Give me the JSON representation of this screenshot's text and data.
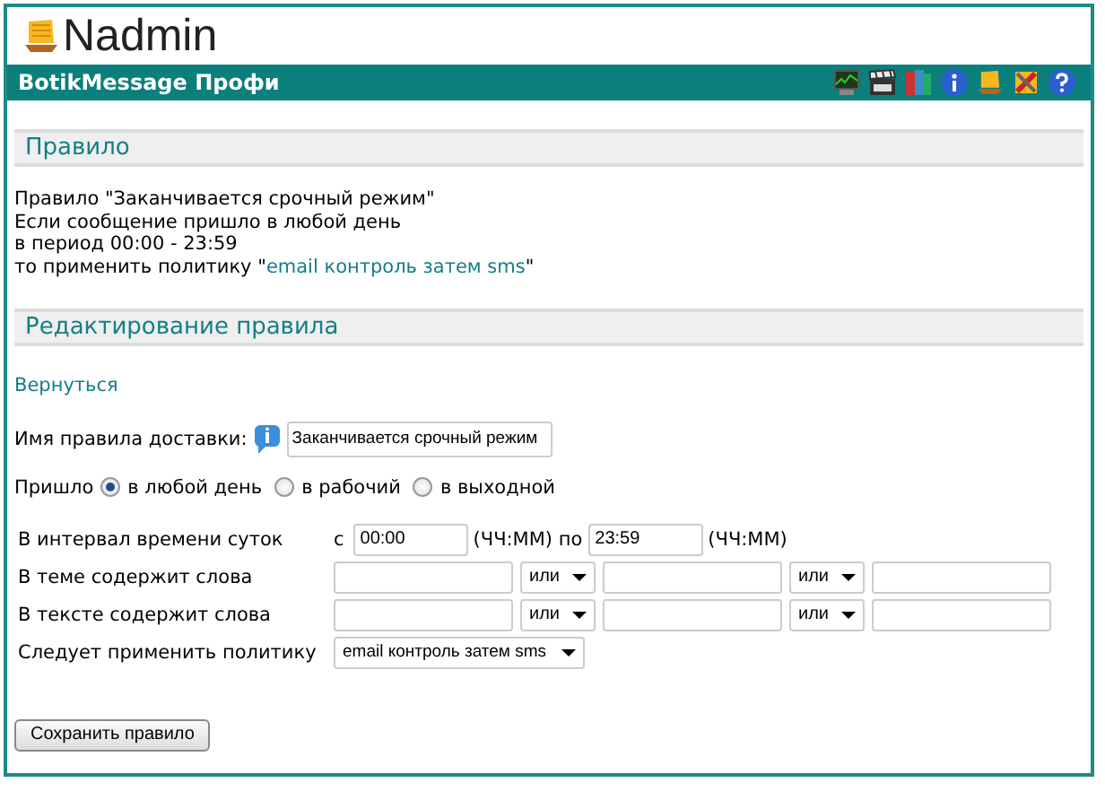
{
  "header": {
    "logo": "Nadmin",
    "title": "BotikMessage Профи"
  },
  "rule_section": {
    "heading": "Правило",
    "lines": [
      {
        "text": "Правило \"Заканчивается срочный режим\""
      },
      {
        "text": "Если сообщение пришло в любой день"
      },
      {
        "text": "в период 00:00 - 23:59"
      },
      {
        "text": "то применить политику \"",
        "link": "email контроль затем sms",
        "suffix": "\""
      }
    ]
  },
  "edit_section": {
    "heading": "Редактирование правила",
    "back_link": "Вернуться",
    "name_label": "Имя правила доставки:",
    "name_value": "Заканчивается срочный режим",
    "came_label": "Пришло",
    "radios": [
      {
        "label": "в любой день",
        "selected": true
      },
      {
        "label": "в рабочий",
        "selected": false
      },
      {
        "label": "в выходной",
        "selected": false
      }
    ],
    "interval": {
      "label": "В интервал времени суток",
      "from_prefix": "с",
      "from_value": "00:00",
      "from_unit": "(ЧЧ:ММ) по",
      "to_value": "23:59",
      "to_unit": "(ЧЧ:ММ)"
    },
    "word_rows": [
      {
        "label": "В теме содержит слова",
        "operators": [
          "или",
          "или"
        ]
      },
      {
        "label": "В тексте содержит слова",
        "operators": [
          "или",
          "или"
        ]
      }
    ],
    "policy": {
      "label": "Следует применить политику",
      "value": "email контроль затем sms"
    },
    "save_button": "Сохранить правило"
  }
}
